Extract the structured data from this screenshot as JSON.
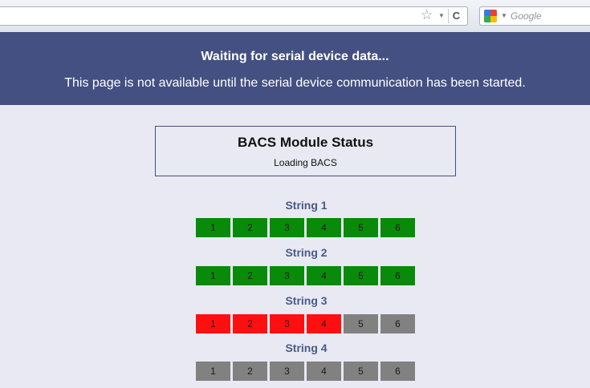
{
  "browser": {
    "search_placeholder": "Google",
    "star_icon": "star-icon",
    "reload_icon": "reload-icon"
  },
  "banner": {
    "title": "Waiting for serial device data...",
    "message": "This page is not available until the serial device communication has been started.",
    "background_color": "#435081"
  },
  "status": {
    "title": "BACS Module Status",
    "subtitle": "Loading BACS"
  },
  "strings": [
    {
      "label": "String 1",
      "modules": [
        {
          "num": "1",
          "state": "green"
        },
        {
          "num": "2",
          "state": "green"
        },
        {
          "num": "3",
          "state": "green"
        },
        {
          "num": "4",
          "state": "green"
        },
        {
          "num": "5",
          "state": "green"
        },
        {
          "num": "6",
          "state": "green"
        }
      ]
    },
    {
      "label": "String 2",
      "modules": [
        {
          "num": "1",
          "state": "green"
        },
        {
          "num": "2",
          "state": "green"
        },
        {
          "num": "3",
          "state": "green"
        },
        {
          "num": "4",
          "state": "green"
        },
        {
          "num": "5",
          "state": "green"
        },
        {
          "num": "6",
          "state": "green"
        }
      ]
    },
    {
      "label": "String 3",
      "modules": [
        {
          "num": "1",
          "state": "red"
        },
        {
          "num": "2",
          "state": "red"
        },
        {
          "num": "3",
          "state": "red"
        },
        {
          "num": "4",
          "state": "red"
        },
        {
          "num": "5",
          "state": "gray"
        },
        {
          "num": "6",
          "state": "gray"
        }
      ]
    },
    {
      "label": "String 4",
      "modules": [
        {
          "num": "1",
          "state": "gray"
        },
        {
          "num": "2",
          "state": "gray"
        },
        {
          "num": "3",
          "state": "gray"
        },
        {
          "num": "4",
          "state": "gray"
        },
        {
          "num": "5",
          "state": "gray"
        },
        {
          "num": "6",
          "state": "gray"
        }
      ]
    }
  ],
  "state_colors": {
    "green": "#0a8a0a",
    "red": "#ff1010",
    "gray": "#818181"
  }
}
